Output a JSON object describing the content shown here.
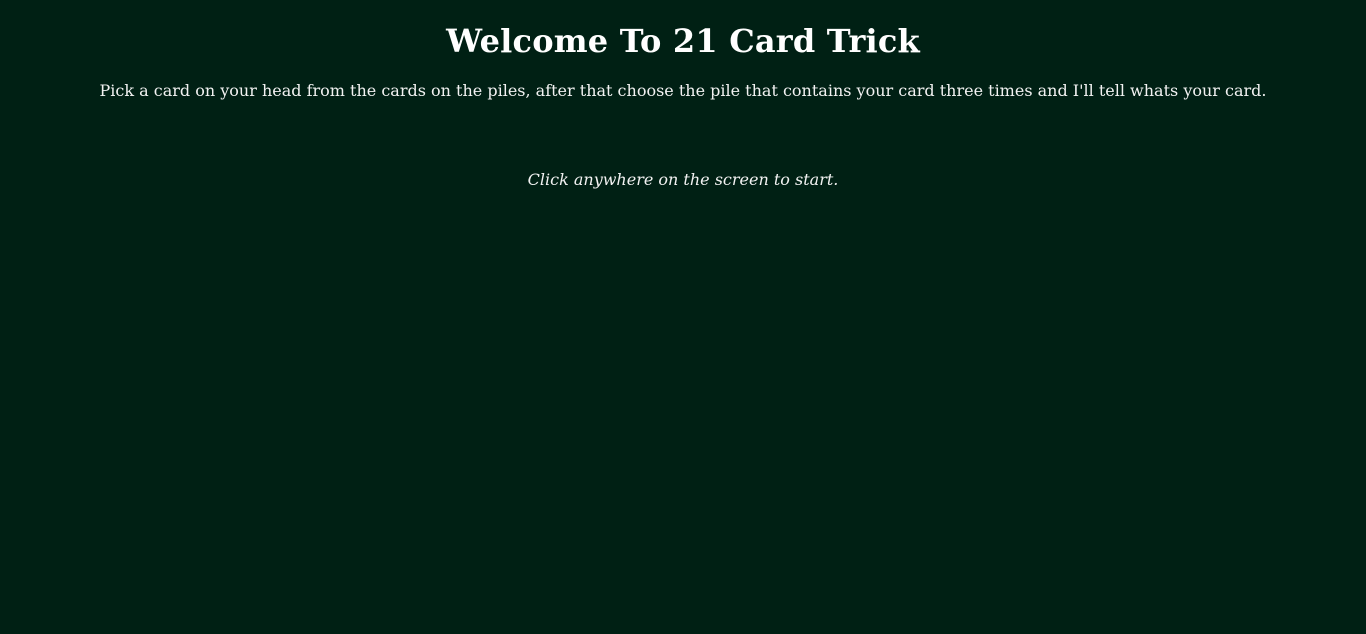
{
  "page": {
    "title": "Welcome To 21 Card Trick",
    "instructions": "Pick a card on your head from the cards on the piles, after that choose the pile that contains your card three times and I'll tell whats your card.",
    "start_hint": "Click anywhere on the screen to start."
  },
  "colors": {
    "background": "#002014",
    "text": "#ffffff"
  }
}
